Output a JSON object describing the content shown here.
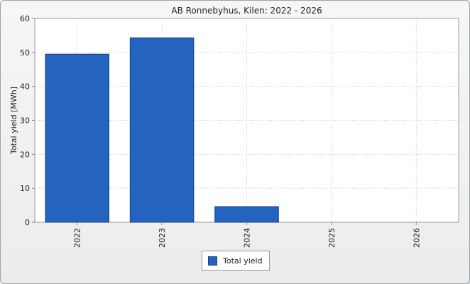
{
  "chart_data": {
    "type": "bar",
    "title": "AB Ronnebyhus, Kilen: 2022 - 2026",
    "xlabel": "",
    "ylabel": "Total yield [MWh]",
    "categories": [
      "2022",
      "2023",
      "2024",
      "2025",
      "2026"
    ],
    "series": [
      {
        "name": "Total yield",
        "values": [
          49.5,
          54.3,
          4.6,
          0,
          0
        ]
      }
    ],
    "ylim": [
      0,
      60
    ],
    "yticks": [
      "0",
      "10",
      "20",
      "30",
      "40",
      "50",
      "60"
    ],
    "grid": true,
    "legend_position": "bottom",
    "colors": {
      "bar": "#2563c0",
      "bar_border": "#1a3f80",
      "plot_background": "#ffffff",
      "grid": "#c8c8c8"
    }
  }
}
